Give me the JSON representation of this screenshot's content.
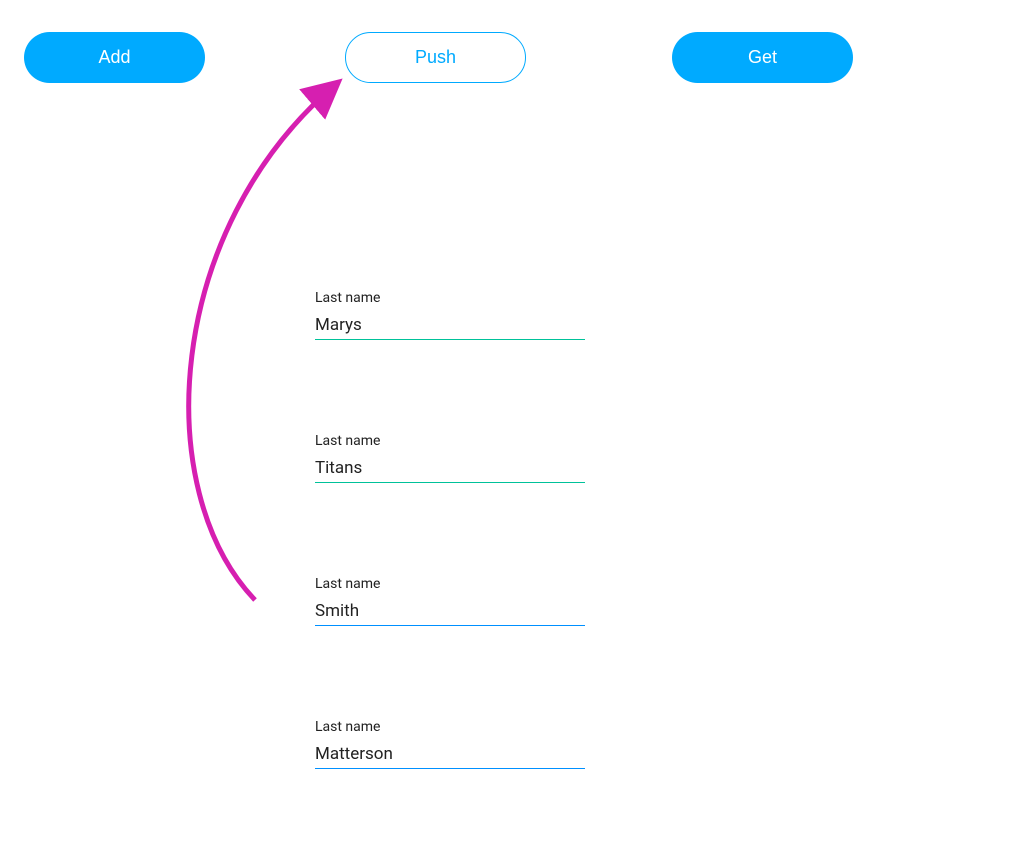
{
  "buttons": {
    "add": "Add",
    "push": "Push",
    "get": "Get"
  },
  "fields": [
    {
      "label": "Last name",
      "value": "Marys",
      "underline": "green"
    },
    {
      "label": "Last name",
      "value": "Titans",
      "underline": "green"
    },
    {
      "label": "Last name",
      "value": "Smith",
      "underline": "blue"
    },
    {
      "label": "Last name",
      "value": "Matterson",
      "underline": "blue"
    }
  ],
  "annotation": {
    "arrowColor": "#d61fb0"
  }
}
